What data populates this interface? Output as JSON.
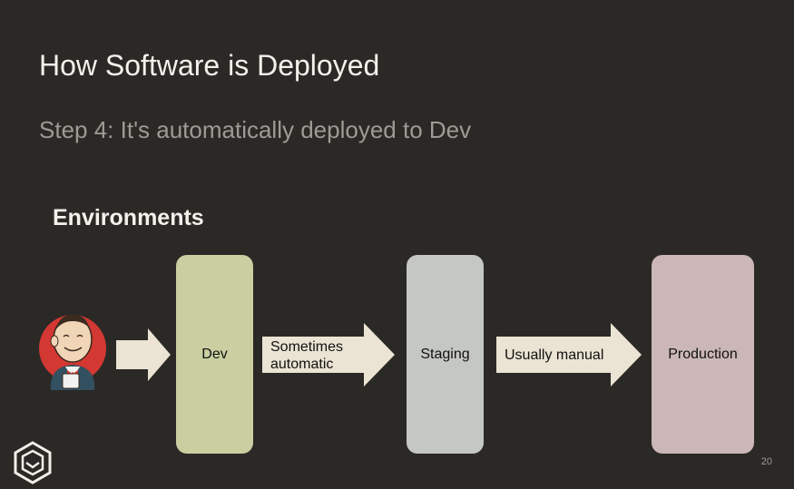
{
  "slide": {
    "title": "How Software is Deployed",
    "subtitle": "Step 4: It's automatically deployed to Dev",
    "section_heading": "Environments",
    "page_number": "20"
  },
  "diagram": {
    "environments": [
      {
        "label": "Dev",
        "color": "#c9cfa1"
      },
      {
        "label": "Staging",
        "color": "#c5c7c2"
      },
      {
        "label": "Production",
        "color": "#cbb7b7"
      }
    ],
    "arrows": [
      {
        "label": ""
      },
      {
        "label": "Sometimes automatic"
      },
      {
        "label": "Usually manual"
      }
    ],
    "arrow_color": "#ebe3d3",
    "icons": [
      "jenkins-butler-icon",
      "brand-logo-icon"
    ]
  }
}
